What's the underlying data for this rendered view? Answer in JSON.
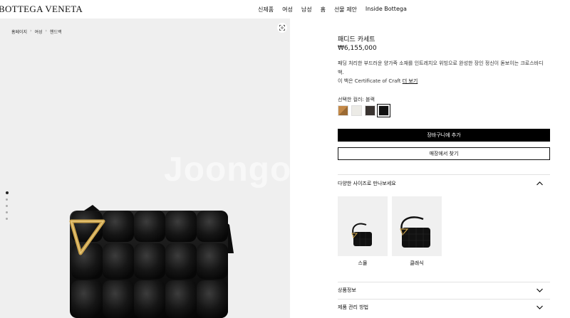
{
  "header": {
    "logo": "BOTTEGA VENETA",
    "nav": [
      "신제품",
      "여성",
      "남성",
      "홈",
      "선물 제안",
      "Inside Bottega"
    ]
  },
  "breadcrumb": [
    "홈페이지",
    "여성",
    "핸드백"
  ],
  "watermark": "Joongo",
  "product": {
    "title": "패디드 카세트",
    "price": "₩6,155,000",
    "description": "패딩 처리한 부드러운 양가죽 소재를 인트레치오 위빙으로 완성한 장인 정신이 돋보이는 크로스바디 백.",
    "craft_prefix": "이 백은 Certificate of Craft",
    "craft_link": "더 보기",
    "color_label": "선택한 컬러: 블랙",
    "swatches": [
      {
        "name": "caramel",
        "color": "#b07a3e"
      },
      {
        "name": "white",
        "color": "#ecebe6"
      },
      {
        "name": "dark-brown",
        "color": "#3a3431"
      },
      {
        "name": "black",
        "color": "#111111"
      }
    ],
    "add_to_cart": "장바구니에 추가",
    "find_in_store": "매장에서 찾기"
  },
  "sizes": {
    "heading": "다양한 사이즈로 만나보세요",
    "items": [
      {
        "label": "스몰"
      },
      {
        "label": "클래식"
      }
    ]
  },
  "accordion": {
    "product_info": "상품정보",
    "care": "제품 관리 방법"
  },
  "colors": {
    "accent": "#000000",
    "panel_bg": "#efefef",
    "hardware": "#c9a14a"
  }
}
